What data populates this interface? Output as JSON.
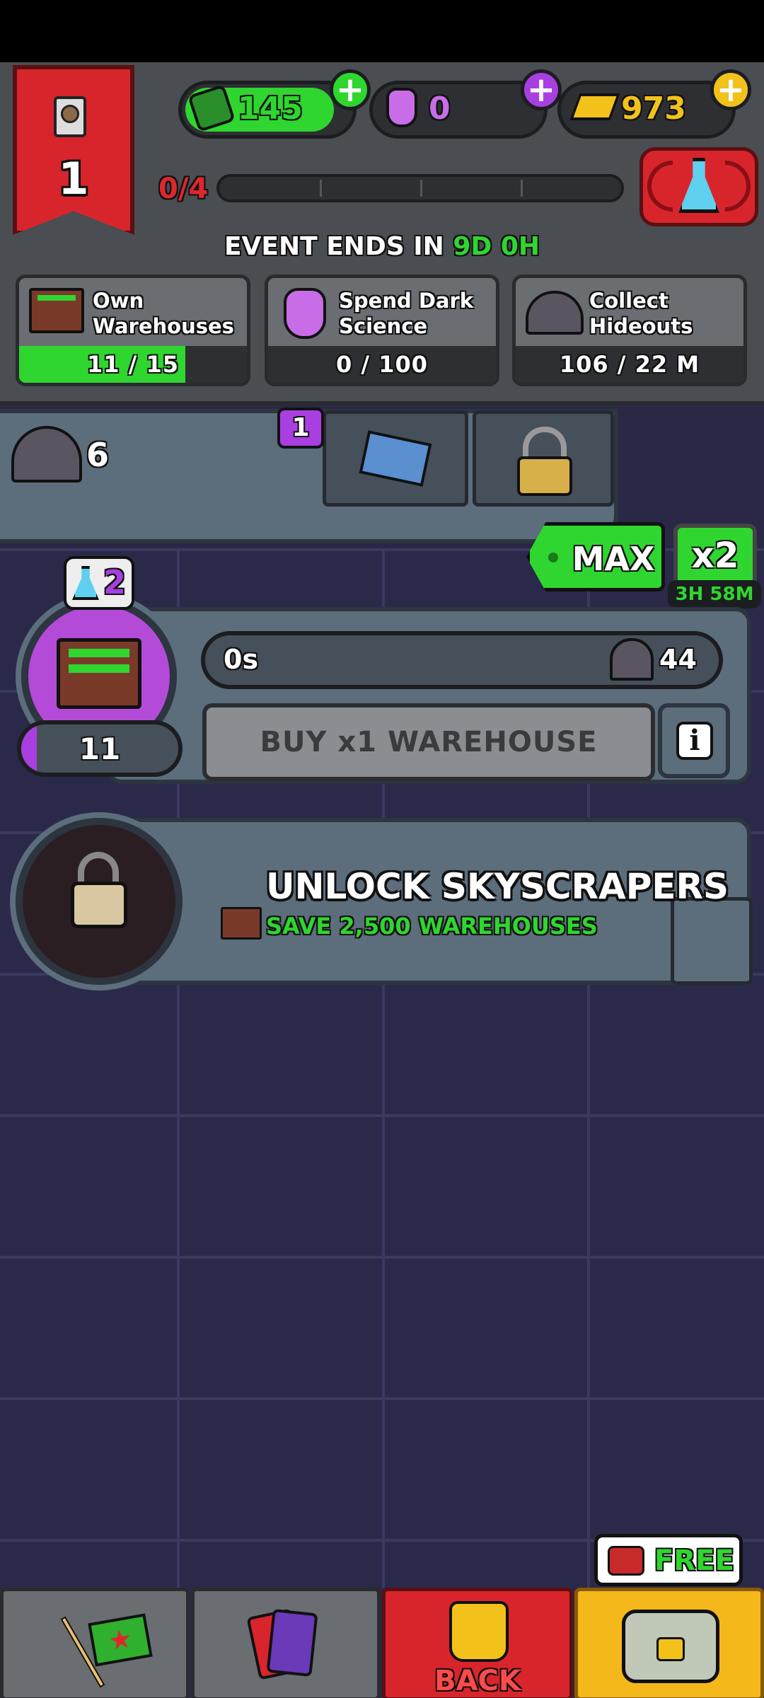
{
  "currencies": {
    "cash": {
      "value": "145",
      "color": "#2fd62f",
      "icon": "cash-bundle-icon"
    },
    "dark_science": {
      "value": "0",
      "color": "#a93fe0",
      "icon": "dark-science-potion-icon"
    },
    "gold": {
      "value": "973",
      "color": "#f2c21b",
      "icon": "gold-bars-icon"
    }
  },
  "event": {
    "rank": "1",
    "progress": "0/4",
    "ends_label": "EVENT ENDS IN",
    "ends_days": "9D",
    "ends_hours": "0H"
  },
  "missions": [
    {
      "label": "Own Warehouses",
      "line1": "Own",
      "line2": "Warehouses",
      "progress_text": "11 / 15",
      "fraction": 0.73,
      "icon": "warehouse-icon"
    },
    {
      "label": "Spend Dark Science",
      "line1": "Spend Dark",
      "line2": "Science",
      "progress_text": "0 / 100",
      "fraction": 0,
      "icon": "dark-science-potion-icon"
    },
    {
      "label": "Collect Hideouts",
      "line1": "Collect",
      "line2": "Hideouts",
      "progress_text": "106 / 22 M",
      "fraction": 0,
      "icon": "hideout-icon"
    }
  ],
  "hideouts": {
    "count": "6",
    "map_badge": "1"
  },
  "multiplier": {
    "max_label": "MAX",
    "x2_label": "x2",
    "timer": "3H 58M"
  },
  "warehouse": {
    "science_badge": "2",
    "level": "11",
    "level_fraction": 0.1,
    "timer": "0s",
    "reward": "44",
    "buy_label": "BUY x1 WAREHOUSE"
  },
  "unlock": {
    "title": "UNLOCK SKYSCRAPERS",
    "requirement": "SAVE 2,500 WAREHOUSES"
  },
  "bottom_nav": {
    "free_label": "FREE",
    "back_label": "BACK"
  }
}
